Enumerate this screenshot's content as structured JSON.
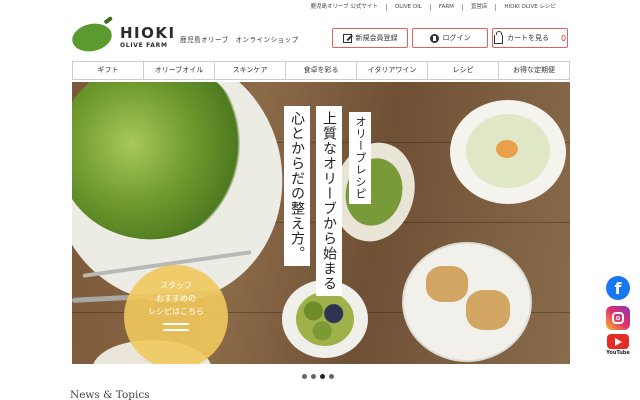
{
  "top_links": [
    "鹿児島オリーブ 公式サイト",
    "OLIVE OIL",
    "FARM",
    "直営店",
    "HIOKI OLIVE レシピ"
  ],
  "logo": {
    "name": "HIOKI",
    "sub": "OLIVE FARM"
  },
  "tagline": "鹿児島オリーブ　オンラインショップ",
  "header_buttons": {
    "register": "新規会員登録",
    "login": "ログイン",
    "cart": "カートを見る",
    "cart_count": "0"
  },
  "nav": [
    "ギフト",
    "オリーブオイル",
    "スキンケア",
    "食卓を彩る",
    "イタリアワイン",
    "レシピ",
    "お得な定期便"
  ],
  "hero": {
    "line1": "オリーブレシピ",
    "line2": "上質なオリーブから始まる",
    "line3": "心とからだの整え方。",
    "staff_lines": [
      "スタッフ",
      "おすすめの",
      "レシピはこちら"
    ]
  },
  "slider": {
    "count": 4,
    "active": 3
  },
  "news_title": "News & Topics",
  "social": {
    "youtube_label": "YouTube",
    "facebook_letter": "f"
  },
  "colors": {
    "accent": "#e06060",
    "olive": "#5a9a2e",
    "staff_badge": "#f0c85c"
  }
}
